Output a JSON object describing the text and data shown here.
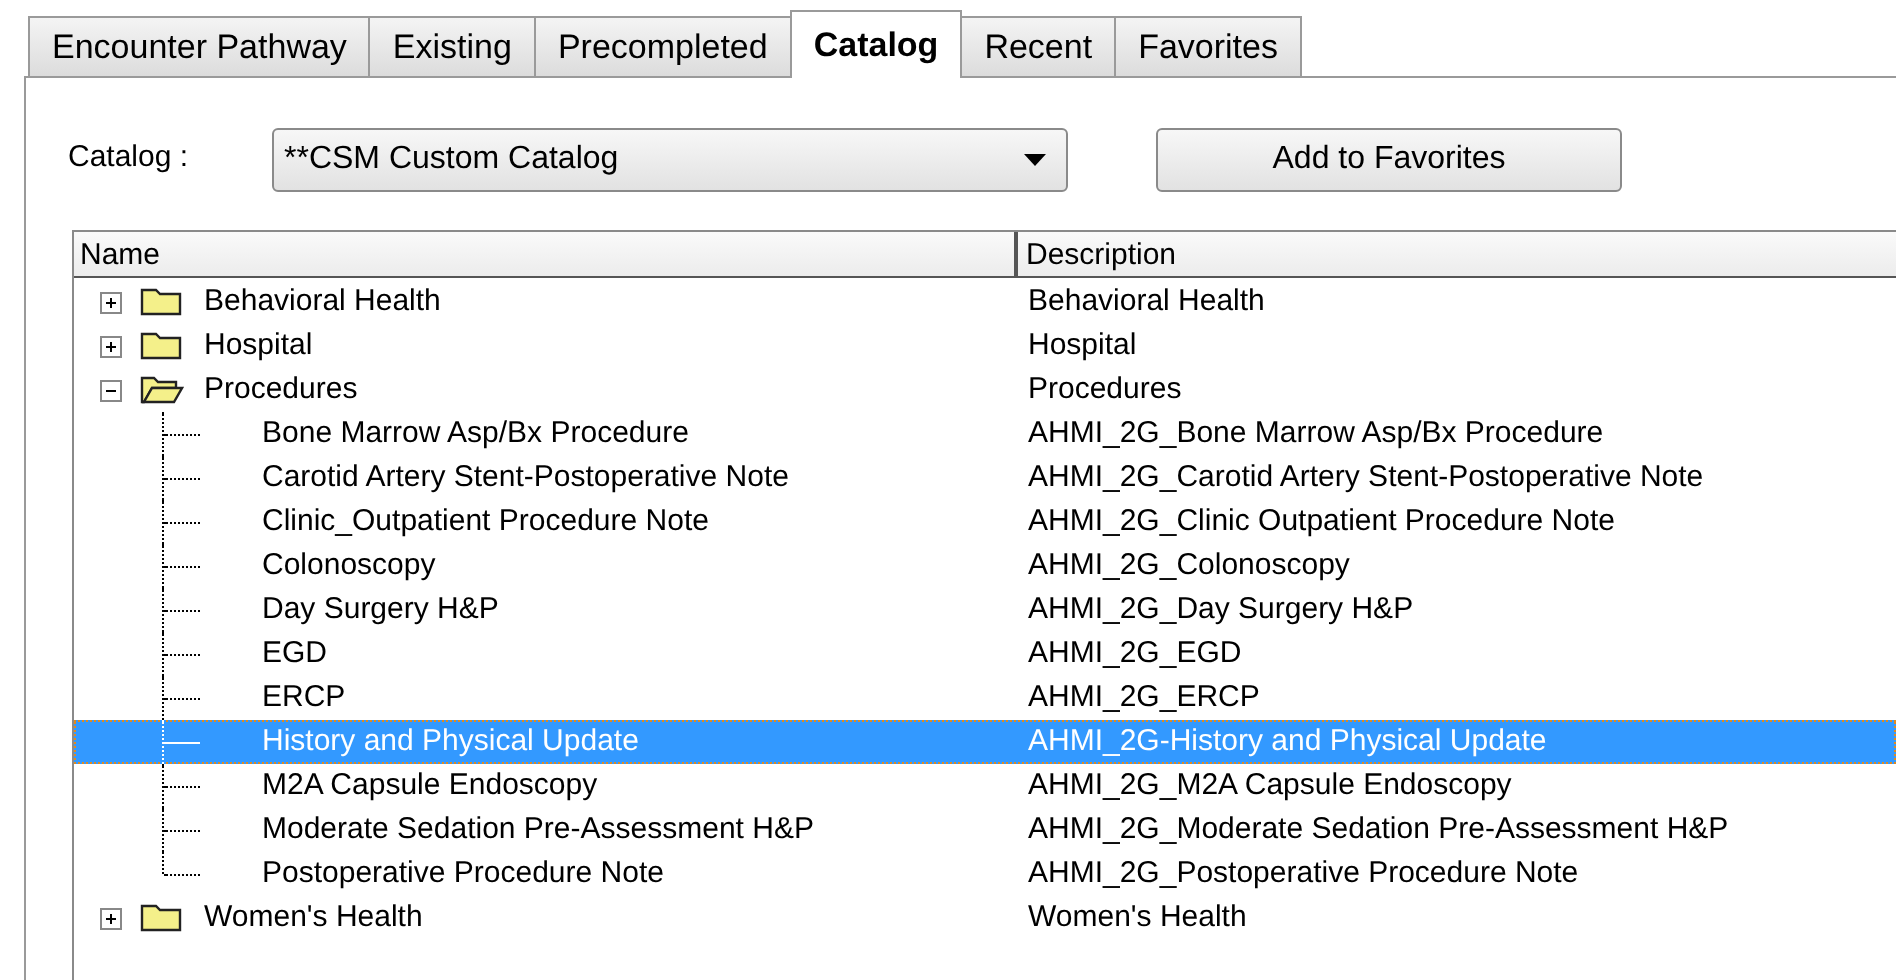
{
  "tabs": [
    {
      "label": "Encounter Pathway",
      "selected": false
    },
    {
      "label": "Existing",
      "selected": false
    },
    {
      "label": "Precompleted",
      "selected": false
    },
    {
      "label": "Catalog",
      "selected": true
    },
    {
      "label": "Recent",
      "selected": false
    },
    {
      "label": "Favorites",
      "selected": false
    }
  ],
  "catalog": {
    "label": "Catalog :",
    "value": "**CSM Custom Catalog"
  },
  "add_button": "Add to Favorites",
  "tree": {
    "columns": [
      "Name",
      "Description"
    ],
    "items": [
      {
        "name": "Behavioral Health",
        "description": "Behavioral Health",
        "expanded": false,
        "selected": false
      },
      {
        "name": "Hospital",
        "description": "Hospital",
        "expanded": false,
        "selected": false
      },
      {
        "name": "Procedures",
        "description": "Procedures",
        "expanded": true,
        "selected": false,
        "children": [
          {
            "name": "Bone Marrow Asp/Bx Procedure",
            "description": "AHMI_2G_Bone Marrow Asp/Bx Procedure",
            "selected": false
          },
          {
            "name": "Carotid Artery Stent-Postoperative Note",
            "description": "AHMI_2G_Carotid Artery Stent-Postoperative Note",
            "selected": false
          },
          {
            "name": "Clinic_Outpatient Procedure Note",
            "description": "AHMI_2G_Clinic Outpatient Procedure Note",
            "selected": false
          },
          {
            "name": "Colonoscopy",
            "description": "AHMI_2G_Colonoscopy",
            "selected": false
          },
          {
            "name": "Day Surgery H&P",
            "description": "AHMI_2G_Day Surgery H&P",
            "selected": false
          },
          {
            "name": "EGD",
            "description": "AHMI_2G_EGD",
            "selected": false
          },
          {
            "name": "ERCP",
            "description": "AHMI_2G_ERCP",
            "selected": false
          },
          {
            "name": "History and Physical Update",
            "description": "AHMI_2G-History and Physical Update",
            "selected": true
          },
          {
            "name": "M2A Capsule Endoscopy",
            "description": "AHMI_2G_M2A Capsule Endoscopy",
            "selected": false
          },
          {
            "name": "Moderate Sedation Pre-Assessment H&P",
            "description": "AHMI_2G_Moderate Sedation Pre-Assessment H&P",
            "selected": false
          },
          {
            "name": "Postoperative Procedure Note",
            "description": "AHMI_2G_Postoperative Procedure Note",
            "selected": false
          }
        ]
      },
      {
        "name": "Women's Health",
        "description": "Women's Health",
        "expanded": false,
        "selected": false
      }
    ]
  }
}
